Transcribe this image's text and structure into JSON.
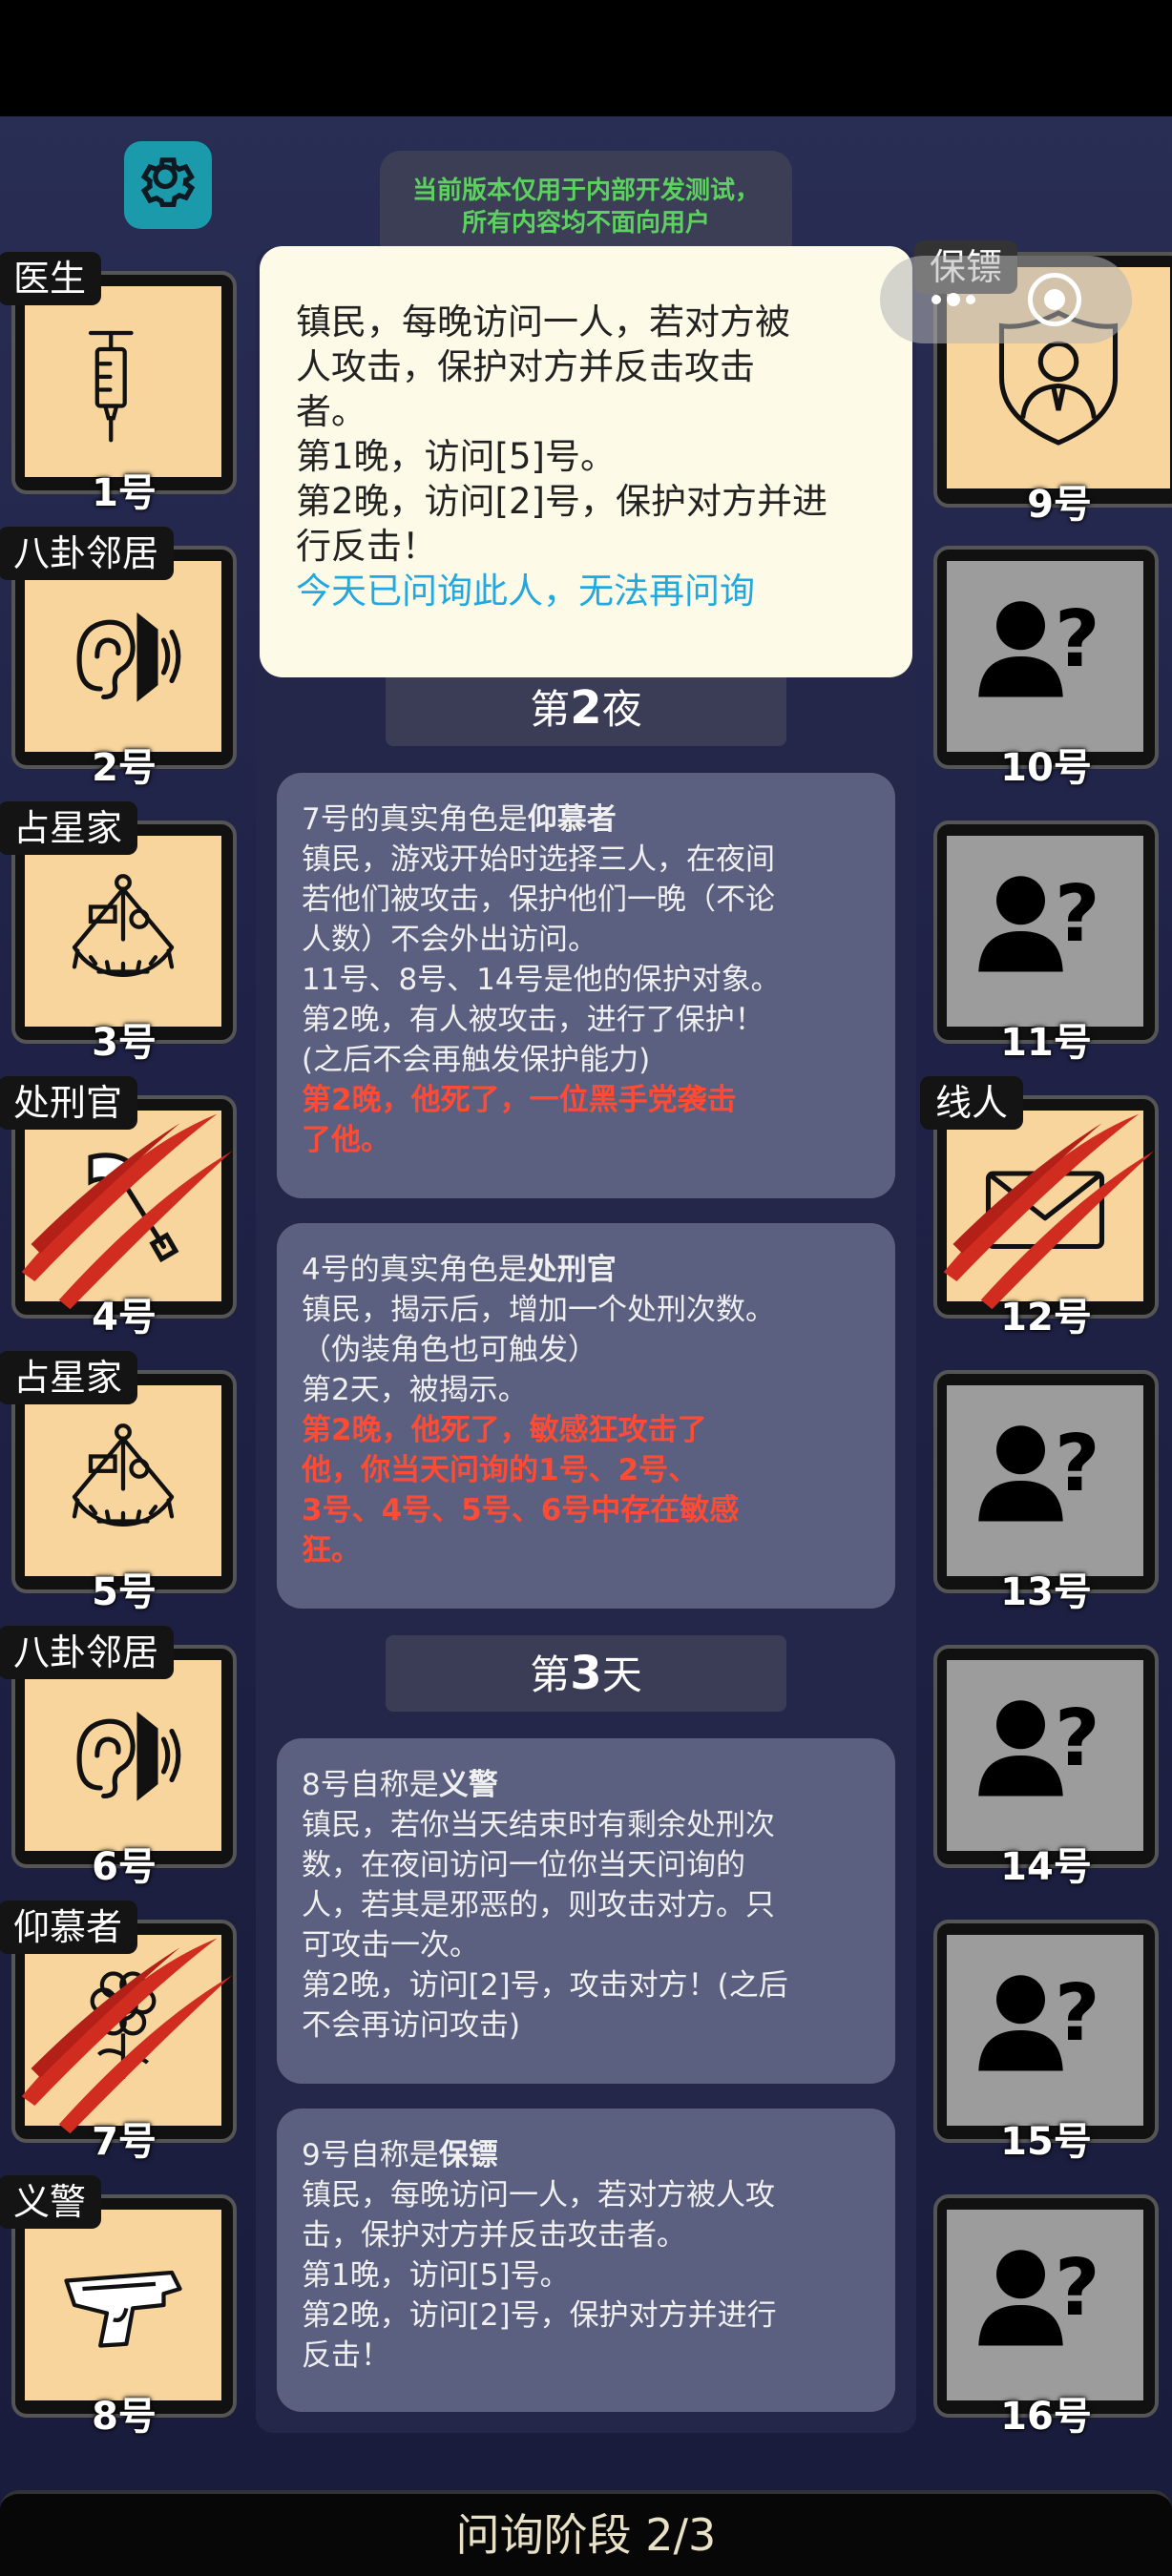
{
  "notice": {
    "line1": "当前版本仅用于内部开发测试，",
    "line2": "所有内容均不面向用户"
  },
  "popup": {
    "lines": [
      "镇民，每晚访问一人，若对方被",
      "人攻击，保护对方并反击攻击",
      "者。",
      "第1晚，访问[5]号。",
      "第2晚，访问[2]号，保护对方并进",
      "行反击！"
    ],
    "hint": "今天已问询此人，无法再问询"
  },
  "players_left": [
    {
      "role": "医生",
      "num": "1号",
      "icon": "syringe-icon",
      "dead": false
    },
    {
      "role": "八卦邻居",
      "num": "2号",
      "icon": "ear-icon",
      "dead": false
    },
    {
      "role": "占星家",
      "num": "3号",
      "icon": "sextant-icon",
      "dead": false
    },
    {
      "role": "处刑官",
      "num": "4号",
      "icon": "axe-icon",
      "dead": true
    },
    {
      "role": "占星家",
      "num": "5号",
      "icon": "sextant-icon",
      "dead": false
    },
    {
      "role": "八卦邻居",
      "num": "6号",
      "icon": "ear-icon",
      "dead": false
    },
    {
      "role": "仰慕者",
      "num": "7号",
      "icon": "flower-icon",
      "dead": true
    },
    {
      "role": "义警",
      "num": "8号",
      "icon": "pistol-icon",
      "dead": false
    }
  ],
  "players_right": [
    {
      "role": "保镖",
      "num": "9号",
      "icon": "bodyguard-shield-icon",
      "dead": false
    },
    {
      "role": "",
      "num": "10号",
      "icon": "unknown-person-icon",
      "dead": false
    },
    {
      "role": "",
      "num": "11号",
      "icon": "unknown-person-icon",
      "dead": false
    },
    {
      "role": "线人",
      "num": "12号",
      "icon": "envelope-icon",
      "dead": true
    },
    {
      "role": "",
      "num": "13号",
      "icon": "unknown-person-icon",
      "dead": false
    },
    {
      "role": "",
      "num": "14号",
      "icon": "unknown-person-icon",
      "dead": false
    },
    {
      "role": "",
      "num": "15号",
      "icon": "unknown-person-icon",
      "dead": false
    },
    {
      "role": "",
      "num": "16号",
      "icon": "unknown-person-icon",
      "dead": false
    }
  ],
  "phases": {
    "night2_prefix": "第",
    "night2_num": "2",
    "night2_suffix": "夜",
    "day3_prefix": "第",
    "day3_num": "3",
    "day3_suffix": "天"
  },
  "logs": [
    {
      "head_pre": "7号的真实角色是",
      "head_role": "仰慕者",
      "lines": [
        "镇民，游戏开始时选择三人，在夜间",
        "若他们被攻击，保护他们一晚（不论",
        "人数）不会外出访问。",
        "11号、8号、14号是他的保护对象。",
        "第2晚，有人被攻击，进行了保护！",
        "(之后不会再触发保护能力)"
      ],
      "red": [
        "第2晚，他死了，一位黑手党袭击",
        "了他。"
      ]
    },
    {
      "head_pre": "4号的真实角色是",
      "head_role": "处刑官",
      "lines": [
        "镇民，揭示后，增加一个处刑次数。",
        "（伪装角色也可触发）",
        "第2天，被揭示。"
      ],
      "red": [
        "第2晚，他死了，敏感狂攻击了",
        "他，你当天问询的1号、2号、",
        "3号、4号、5号、6号中存在敏感",
        "狂。"
      ]
    },
    {
      "head_pre": "8号自称是",
      "head_role": "义警",
      "lines": [
        "镇民，若你当天结束时有剩余处刑次",
        "数，在夜间访问一位你当天问询的",
        "人，若其是邪恶的，则攻击对方。只",
        "可攻击一次。",
        "第2晚，访问[2]号，攻击对方！(之后",
        "不会再访问攻击)"
      ],
      "red": []
    },
    {
      "head_pre": "9号自称是",
      "head_role": "保镖",
      "lines": [
        "镇民，每晚访问一人，若对方被人攻",
        "击，保护对方并反击攻击者。",
        "第1晚，访问[5]号。",
        "第2晚，访问[2]号，保护对方并进行",
        "反击！"
      ],
      "red": []
    }
  ],
  "bottom": {
    "label": "问询阶段 2/3"
  }
}
